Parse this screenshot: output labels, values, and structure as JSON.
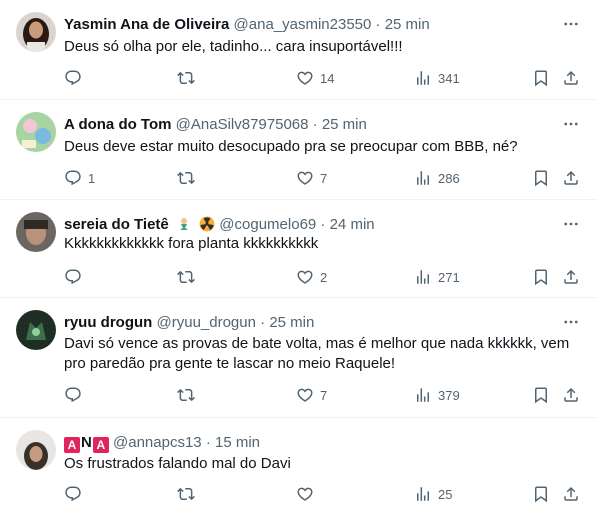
{
  "tweets": [
    {
      "name": "Yasmin Ana de Oliveira",
      "handle": "@ana_yasmin23550",
      "separator": "·",
      "time": "25 min",
      "text": "Deus só olha por ele, tadinho... cara insuportável!!!",
      "replies": "",
      "retweets": "",
      "likes": "14",
      "views": "341"
    },
    {
      "name": "A dona do Tom",
      "handle": "@AnaSilv87975068",
      "separator": "·",
      "time": "25 min",
      "text": "Deus deve estar muito desocupado pra se preocupar com BBB, né?",
      "replies": "1",
      "retweets": "",
      "likes": "7",
      "views": "286"
    },
    {
      "name": "sereia do Tietê",
      "name_emojis": [
        "mermaid-emoji",
        "radioactive-emoji"
      ],
      "handle": "@cogumelo69",
      "separator": "·",
      "time": "24 min",
      "text": "Kkkkkkkkkkkkk fora planta kkkkkkkkkk",
      "replies": "",
      "retweets": "",
      "likes": "2",
      "views": "271"
    },
    {
      "name": "ryuu drogun",
      "handle": "@ryuu_drogun",
      "separator": "·",
      "time": "25 min",
      "text": "Davi só vence as provas de bate volta, mas é melhor que nada kkkkkk, vem pro paredão pra gente te lascar no meio Raquele!",
      "replies": "",
      "retweets": "",
      "likes": "7",
      "views": "379"
    },
    {
      "name_parts": [
        "A",
        "N",
        "A"
      ],
      "handle": "@annapcs13",
      "separator": "·",
      "time": "15 min",
      "text": "Os frustrados falando mal do Davi",
      "replies": "",
      "retweets": "",
      "likes": "",
      "views": "25"
    }
  ],
  "colors": {
    "text": "#0f1419",
    "secondary": "#536471",
    "divider": "#eff3f4",
    "badge": "#e0245e"
  },
  "icons": {
    "reply": "reply-icon",
    "retweet": "retweet-icon",
    "like": "heart-icon",
    "views": "views-icon",
    "bookmark": "bookmark-icon",
    "share": "share-icon",
    "more": "more-icon"
  }
}
